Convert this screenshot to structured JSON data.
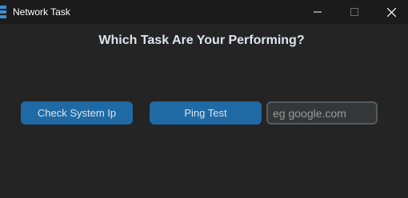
{
  "window": {
    "title": "Network Task",
    "icon": "app-icon",
    "controls": [
      "minimize-icon",
      "maximize-icon",
      "close-icon"
    ]
  },
  "main": {
    "heading": "Which Task Are Your Performing?",
    "buttons": {
      "check_ip_label": "Check System Ip",
      "ping_label": "Ping Test"
    },
    "host_input": {
      "value": "",
      "placeholder": "eg google.com"
    }
  },
  "colors": {
    "background": "#242424",
    "titlebar": "#1b1b1b",
    "button": "#1f6aa5",
    "input_bg": "#343638",
    "input_border": "#565b5e",
    "text": "#dce4ee"
  }
}
